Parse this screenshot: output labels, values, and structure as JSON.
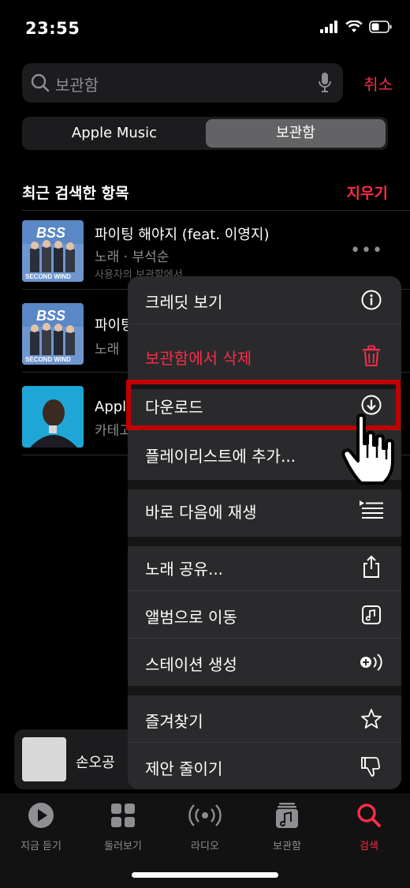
{
  "status": {
    "time": "23:55"
  },
  "search": {
    "placeholder": "보관함",
    "cancel_label": "취소"
  },
  "segment": {
    "left": "Apple Music",
    "right": "보관함"
  },
  "section": {
    "title": "최근 검색한 항목",
    "clear": "지우기"
  },
  "results": [
    {
      "title": "파이팅 해야지 (feat. 이영지)",
      "subtitle": "노래 · 부석순",
      "subtitle2": "사용자의 보관함에서"
    },
    {
      "title": "파이팅",
      "subtitle": "노래"
    },
    {
      "title": "Appl",
      "subtitle": "카테고"
    }
  ],
  "mini_player": {
    "title": "손오공"
  },
  "menu": {
    "credits": "크레딧 보기",
    "delete": "보관함에서 삭제",
    "download": "다운로드",
    "add_playlist": "플레이리스트에 추가...",
    "play_next": "바로 다음에 재생",
    "share": "노래 공유...",
    "go_album": "앨범으로 이동",
    "station": "스테이션 생성",
    "favorite": "즐겨찾기",
    "suggest_less": "제안 줄이기"
  },
  "tabs": [
    {
      "label": "지금 듣기",
      "icon": "play-circle-icon"
    },
    {
      "label": "둘러보기",
      "icon": "grid-icon"
    },
    {
      "label": "라디오",
      "icon": "radio-icon"
    },
    {
      "label": "보관함",
      "icon": "library-icon"
    },
    {
      "label": "검색",
      "icon": "search-icon"
    }
  ],
  "colors": {
    "accent": "#fa2d48",
    "highlight": "#c00000"
  },
  "album_art": {
    "text1": "BSS",
    "text2": "SECOND WIND"
  }
}
